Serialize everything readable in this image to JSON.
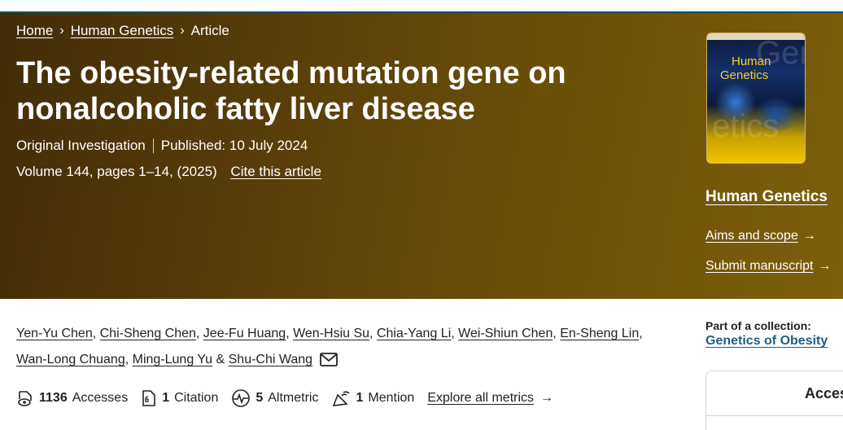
{
  "breadcrumb": {
    "home": "Home",
    "journal": "Human Genetics",
    "current": "Article"
  },
  "article": {
    "title": "The obesity-related mutation gene on nonalcoholic fatty liver disease",
    "type": "Original Investigation",
    "published": "Published: 10 July 2024",
    "volume": "Volume 144, pages 1–14, (2025)",
    "cite": "Cite this article"
  },
  "authors": [
    "Yen-Yu Chen",
    "Chi-Sheng Chen",
    "Jee-Fu Huang",
    "Wen-Hsiu Su",
    "Chia-Yang Li",
    "Wei-Shiun Chen",
    "En-Sheng Lin",
    "Wan-Long Chuang",
    "Ming-Lung Yu",
    "Shu-Chi Wang"
  ],
  "metrics": {
    "accesses_count": "1136",
    "accesses_label": "Accesses",
    "citation_count": "1",
    "citation_label": "Citation",
    "altmetric_count": "5",
    "altmetric_label": "Altmetric",
    "mention_count": "1",
    "mention_label": "Mention",
    "explore": "Explore all metrics"
  },
  "sidebar": {
    "cover_title_line1": "Human",
    "cover_title_line2": "Genetics",
    "journal_name": "Human Genetics",
    "aims": "Aims and scope",
    "submit": "Submit manuscript",
    "collection_label": "Part of a collection:",
    "collection_name": "Genetics of Obesity",
    "access_label": "Acces"
  },
  "icons": [
    "chevron-right-icon",
    "arrow-right-icon",
    "mail-icon",
    "accesses-icon",
    "citation-icon",
    "altmetric-icon",
    "mention-icon"
  ],
  "colors": {
    "hero_start": "#432d08",
    "hero_end": "#7c5e0c",
    "link_blue": "#1f5e86",
    "cover_yellow": "#f7cf2a"
  }
}
